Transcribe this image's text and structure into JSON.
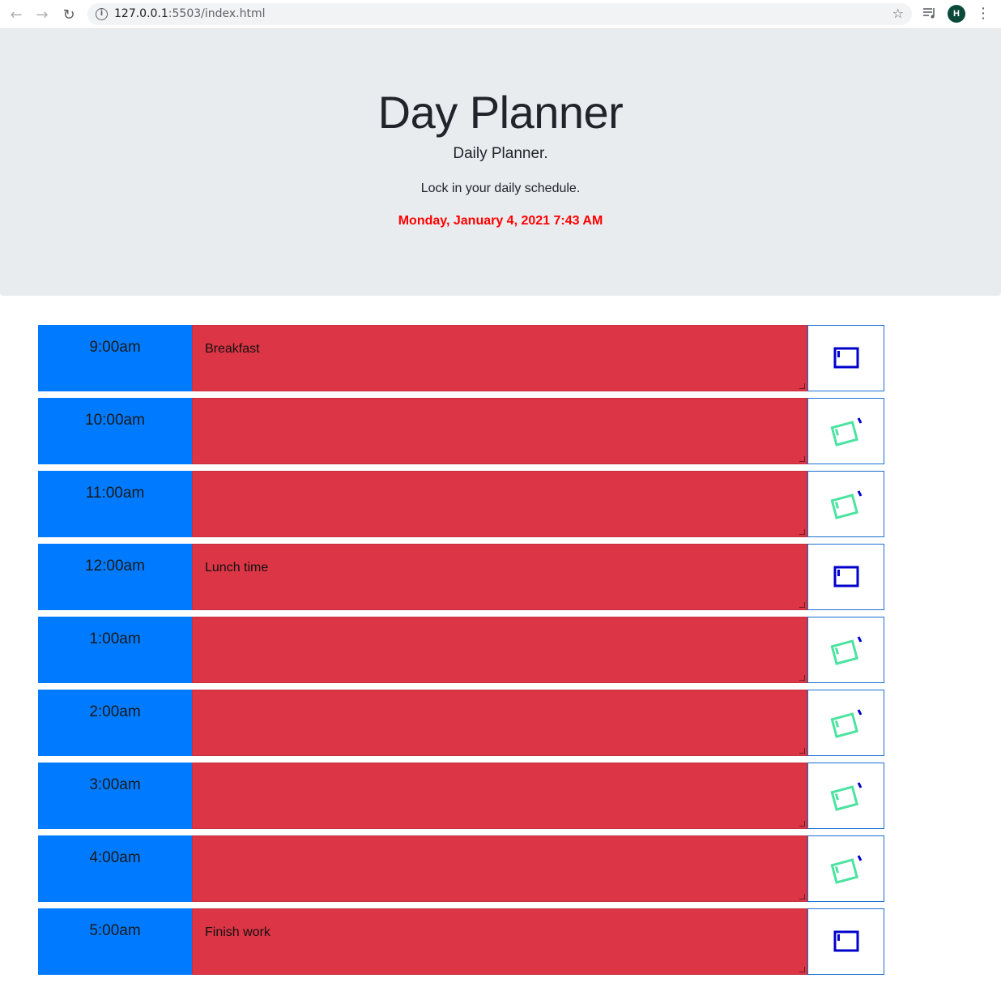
{
  "browser": {
    "url_host": "127.0.0.1",
    "url_rest": ":5503/index.html",
    "profile_initial": "H"
  },
  "header": {
    "title": "Day Planner",
    "lead": "Daily Planner.",
    "tagline": "Lock in your daily schedule.",
    "current_day": "Monday, January 4, 2021 7:43 AM"
  },
  "colors": {
    "hour_bg": "#007bff",
    "past_block": "#dc3545",
    "date_text": "#ff0000",
    "saved_icon": "#0000cc",
    "unsaved_icon": "#4be3a0"
  },
  "time_blocks": [
    {
      "hour": "9:00am",
      "text": "Breakfast",
      "icon": "floppy-disk-icon"
    },
    {
      "hour": "10:00am",
      "text": "",
      "icon": "save-pending-icon"
    },
    {
      "hour": "11:00am",
      "text": "",
      "icon": "save-pending-icon"
    },
    {
      "hour": "12:00am",
      "text": "Lunch time",
      "icon": "floppy-disk-icon"
    },
    {
      "hour": "1:00am",
      "text": "",
      "icon": "save-pending-icon"
    },
    {
      "hour": "2:00am",
      "text": "",
      "icon": "save-pending-icon"
    },
    {
      "hour": "3:00am",
      "text": "",
      "icon": "save-pending-icon"
    },
    {
      "hour": "4:00am",
      "text": "",
      "icon": "save-pending-icon"
    },
    {
      "hour": "5:00am",
      "text": "Finish work",
      "icon": "floppy-disk-icon"
    }
  ]
}
